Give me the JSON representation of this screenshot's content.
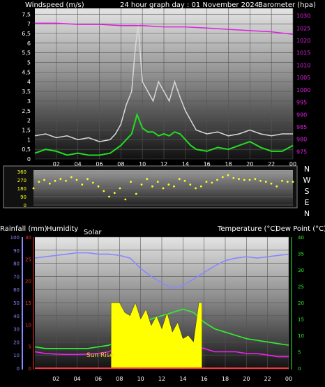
{
  "header": {
    "windspeed_label": "Windspeed (m/s)",
    "graph_title": "24 hour graph day : 01 November 2024",
    "barometer_label": "Barometer (hpa)"
  },
  "direction_labels": [
    "N",
    "W",
    "S",
    "E",
    "N"
  ],
  "bottom_labels": {
    "rainfall": "Rainfall (mm)",
    "humidity": "Humidity",
    "solar": "Solar",
    "temperature": "Temperature (°C)",
    "dew_point": "Dew Point (°C)",
    "sun_rise": "Sun Rise"
  },
  "colors": {
    "wind_gust": "#d8d8d8",
    "wind_avg": "#22dd22",
    "barometer": "#e020e0",
    "wind_dir": "#ffff22",
    "humidity": "#8888ff",
    "solar": "#ffff00",
    "temperature": "#33ee33",
    "dew_point": "#ee22ee",
    "rainfall": "#ff3333"
  },
  "chart_data": [
    {
      "type": "line",
      "title": "24 hour graph day : 01 November 2024",
      "x_ticks": [
        "02",
        "04",
        "06",
        "08",
        "10",
        "12",
        "14",
        "16",
        "18",
        "20",
        "22",
        "00"
      ],
      "xlim_hours": [
        0,
        24
      ],
      "left_axis": {
        "label": "Windspeed (m/s)",
        "ticks": [
          "0",
          "0,5",
          "1",
          "1,5",
          "2",
          "2,5",
          "3",
          "3,5",
          "4",
          "4,5",
          "5",
          "5,5",
          "6",
          "6,5",
          "7",
          "7,5"
        ],
        "ylim": [
          0,
          7.8
        ]
      },
      "right_axis": {
        "label": "Barometer (hpa)",
        "ticks": [
          "975",
          "980",
          "985",
          "990",
          "995",
          "1000",
          "1005",
          "1010",
          "1015",
          "1020",
          "1025",
          "1030"
        ],
        "ylim": [
          972,
          1033
        ]
      },
      "series": [
        {
          "name": "gust",
          "axis": "left",
          "x": [
            0,
            1,
            2,
            3,
            4,
            5,
            6,
            7,
            7.5,
            8,
            8.5,
            9,
            9.3,
            9.6,
            10,
            10.5,
            11,
            11.5,
            12,
            12.5,
            13,
            13.5,
            14,
            14.5,
            15,
            16,
            17,
            18,
            19,
            20,
            21,
            22,
            23,
            24
          ],
          "y": [
            1.2,
            1.3,
            1.1,
            1.2,
            1.0,
            1.1,
            0.9,
            1.0,
            1.3,
            1.8,
            2.8,
            3.5,
            5.5,
            7.0,
            4.0,
            3.5,
            3.0,
            4.0,
            3.5,
            3.0,
            4.0,
            3.2,
            2.5,
            2.0,
            1.5,
            1.3,
            1.4,
            1.2,
            1.3,
            1.5,
            1.3,
            1.2,
            1.3,
            1.3
          ]
        },
        {
          "name": "average",
          "axis": "left",
          "x": [
            0,
            1,
            2,
            3,
            4,
            5,
            6,
            7,
            7.5,
            8,
            8.5,
            9,
            9.5,
            10,
            10.5,
            11,
            11.5,
            12,
            12.5,
            13,
            13.5,
            14,
            14.5,
            15,
            16,
            17,
            18,
            19,
            20,
            21,
            22,
            23,
            24
          ],
          "y": [
            0.3,
            0.5,
            0.4,
            0.2,
            0.3,
            0.2,
            0.2,
            0.3,
            0.5,
            0.7,
            1.0,
            1.3,
            2.3,
            1.6,
            1.4,
            1.4,
            1.2,
            1.3,
            1.2,
            1.4,
            1.3,
            1.0,
            0.7,
            0.5,
            0.4,
            0.6,
            0.5,
            0.7,
            0.9,
            0.6,
            0.4,
            0.4,
            0.7
          ]
        },
        {
          "name": "barometer",
          "axis": "right",
          "x": [
            0,
            2,
            4,
            6,
            8,
            10,
            12,
            14,
            16,
            18,
            20,
            22,
            24
          ],
          "y": [
            1027,
            1027,
            1026.5,
            1026.5,
            1026,
            1026,
            1025.5,
            1025.5,
            1025,
            1024.5,
            1024,
            1023.5,
            1022.5
          ]
        }
      ]
    },
    {
      "type": "scatter",
      "x_ticks": [
        "02",
        "04",
        "06",
        "08",
        "10",
        "12",
        "14",
        "16",
        "18",
        "20",
        "22",
        "00"
      ],
      "y_ticks": [
        "0",
        "90",
        "180",
        "270",
        "360"
      ],
      "ylim": [
        0,
        360
      ],
      "series": [
        {
          "name": "wind direction",
          "x": [
            0,
            0.5,
            1,
            1.5,
            2,
            2.5,
            3,
            3.5,
            4,
            4.5,
            5,
            5.5,
            6,
            6.5,
            7,
            7.5,
            8,
            8.5,
            9,
            9.5,
            10,
            10.5,
            11,
            11.5,
            12,
            12.5,
            13,
            13.5,
            14,
            14.5,
            15,
            15.5,
            16,
            16.5,
            17,
            17.5,
            18,
            18.5,
            19,
            19.5,
            20,
            20.5,
            21,
            21.5,
            22,
            22.5,
            23,
            23.5,
            24
          ],
          "y": [
            180,
            250,
            270,
            230,
            260,
            280,
            260,
            300,
            270,
            220,
            280,
            240,
            200,
            150,
            90,
            130,
            180,
            60,
            250,
            120,
            220,
            280,
            200,
            250,
            180,
            220,
            200,
            280,
            260,
            220,
            180,
            200,
            250,
            240,
            270,
            300,
            320,
            290,
            280,
            270,
            270,
            280,
            260,
            250,
            230,
            200,
            260,
            250,
            250
          ]
        }
      ]
    },
    {
      "type": "line",
      "x_ticks": [
        "02",
        "04",
        "06",
        "08",
        "10",
        "12",
        "14",
        "16",
        "18",
        "20",
        "22",
        "00"
      ],
      "xlim_hours": [
        0,
        24
      ],
      "axes": {
        "humidity_ticks": [
          "0",
          "10",
          "20",
          "30",
          "40",
          "50",
          "60",
          "70",
          "80",
          "90",
          "100"
        ],
        "rainfall_ticks": [
          "0",
          "5",
          "10",
          "15",
          "20",
          "25",
          "30"
        ],
        "temperature_ticks": [
          "0",
          "5",
          "10",
          "15",
          "20",
          "25",
          "30",
          "35",
          "40"
        ],
        "humidity_ylim": [
          0,
          100
        ],
        "rainfall_ylim": [
          0,
          30
        ],
        "temperature_ylim": [
          0,
          40
        ]
      },
      "series": [
        {
          "name": "Humidity",
          "axis": "humidity",
          "x": [
            0,
            1,
            2,
            3,
            4,
            5,
            6,
            7,
            8,
            9,
            10,
            11,
            12,
            13,
            14,
            15,
            16,
            17,
            18,
            19,
            20,
            21,
            22,
            23,
            24
          ],
          "y": [
            84,
            85,
            86,
            87,
            88,
            88,
            87,
            87,
            86,
            84,
            76,
            70,
            65,
            61,
            63,
            68,
            73,
            78,
            82,
            84,
            85,
            84,
            85,
            86,
            87
          ]
        },
        {
          "name": "Temperature",
          "axis": "temperature",
          "x": [
            0,
            1,
            2,
            3,
            4,
            5,
            6,
            7,
            8,
            9,
            10,
            11,
            12,
            13,
            14,
            15,
            16,
            17,
            18,
            19,
            20,
            21,
            22,
            23,
            24
          ],
          "y": [
            6.5,
            6,
            6,
            6,
            6,
            6,
            6.5,
            7,
            8.5,
            11,
            13.5,
            15,
            16,
            17,
            18,
            17,
            14,
            12,
            11,
            10,
            9,
            8.5,
            8,
            7.5,
            7
          ]
        },
        {
          "name": "Dew Point",
          "axis": "temperature",
          "x": [
            0,
            1,
            2,
            3,
            4,
            5,
            6,
            7,
            8,
            9,
            10,
            11,
            12,
            13,
            14,
            15,
            16,
            17,
            18,
            19,
            20,
            21,
            22,
            23,
            24
          ],
          "y": [
            5,
            4.5,
            4.3,
            4.2,
            4.2,
            4.3,
            4.5,
            5,
            7,
            8,
            8,
            8,
            7.5,
            7.5,
            7.5,
            7,
            6,
            5,
            5,
            5,
            4.5,
            4.5,
            4,
            3.5,
            3.5
          ]
        },
        {
          "name": "Solar",
          "axis": "temperature",
          "x": [
            7.2,
            8,
            8.5,
            9,
            9.5,
            10,
            10.5,
            11,
            11.5,
            12,
            12.5,
            13,
            13.5,
            14,
            14.5,
            15,
            15.5,
            15.8
          ],
          "y": [
            20,
            20,
            17,
            16,
            20,
            15,
            18,
            13,
            16,
            12,
            17,
            11,
            14,
            9,
            10,
            8,
            20,
            20
          ]
        },
        {
          "name": "Rainfall",
          "axis": "rainfall",
          "x": [
            0,
            24
          ],
          "y": [
            0,
            0
          ]
        }
      ]
    }
  ]
}
